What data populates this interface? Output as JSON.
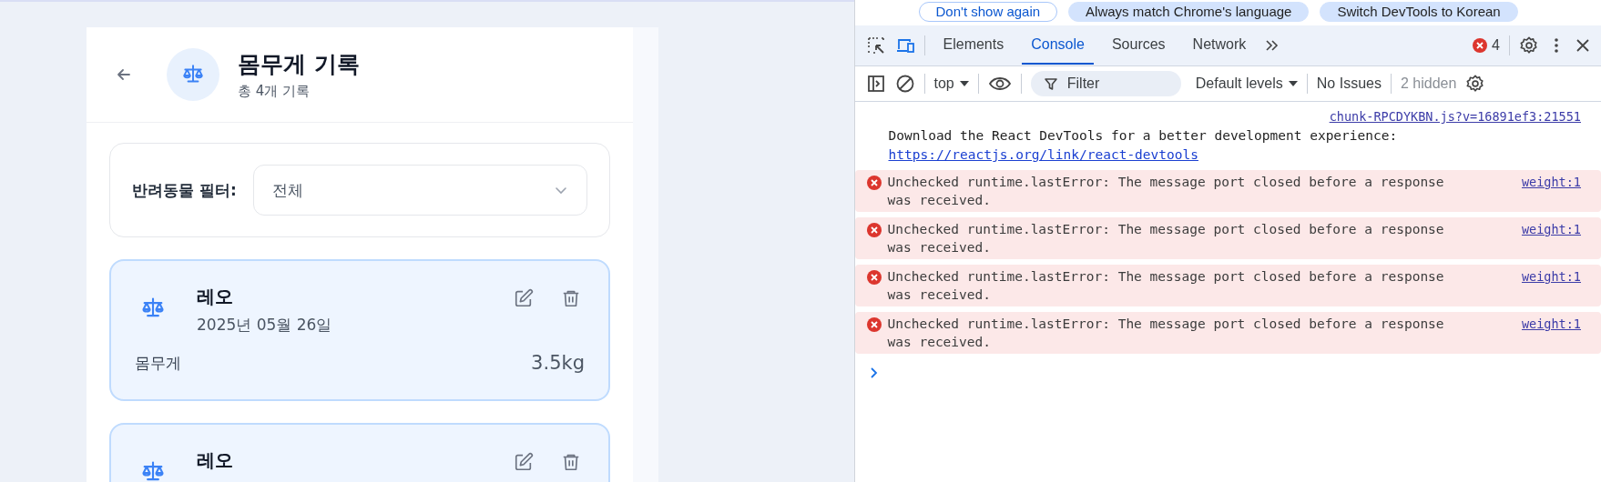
{
  "app": {
    "title": "몸무게 기록",
    "subtitle": "총 4개 기록",
    "filter": {
      "label": "반려동물 필터:",
      "value": "전체"
    },
    "records": [
      {
        "name": "레오",
        "date": "2025년 05월 26일",
        "metric_label": "몸무게",
        "value": "3.5kg"
      },
      {
        "name": "레오"
      }
    ]
  },
  "devtools": {
    "infobar": [
      {
        "label": "Don't show again",
        "kind": "outlined"
      },
      {
        "label": "Always match Chrome's language",
        "kind": "filled"
      },
      {
        "label": "Switch DevTools to Korean",
        "kind": "filled"
      }
    ],
    "tabs": [
      {
        "label": "Elements",
        "selected": false
      },
      {
        "label": "Console",
        "selected": true
      },
      {
        "label": "Sources",
        "selected": false
      },
      {
        "label": "Network",
        "selected": false
      }
    ],
    "error_count": "4",
    "toolbar": {
      "context": "top",
      "filter_placeholder": "Filter",
      "levels": "Default levels",
      "issues": "No Issues",
      "hidden": "2 hidden"
    },
    "messages": [
      {
        "kind": "log",
        "source": "chunk-RPCDYKBN.js?v=16891ef3:21551",
        "text": "Download the React DevTools for a better development experience:",
        "link": "https://reactjs.org/link/react-devtools"
      },
      {
        "kind": "error",
        "text": "Unchecked runtime.lastError: The message port closed before a response was received.",
        "source": "weight:1"
      },
      {
        "kind": "error",
        "text": "Unchecked runtime.lastError: The message port closed before a response was received.",
        "source": "weight:1"
      },
      {
        "kind": "error",
        "text": "Unchecked runtime.lastError: The message port closed before a response was received.",
        "source": "weight:1"
      },
      {
        "kind": "error",
        "text": "Unchecked runtime.lastError: The message port closed before a response was received.",
        "source": "weight:1"
      }
    ]
  }
}
